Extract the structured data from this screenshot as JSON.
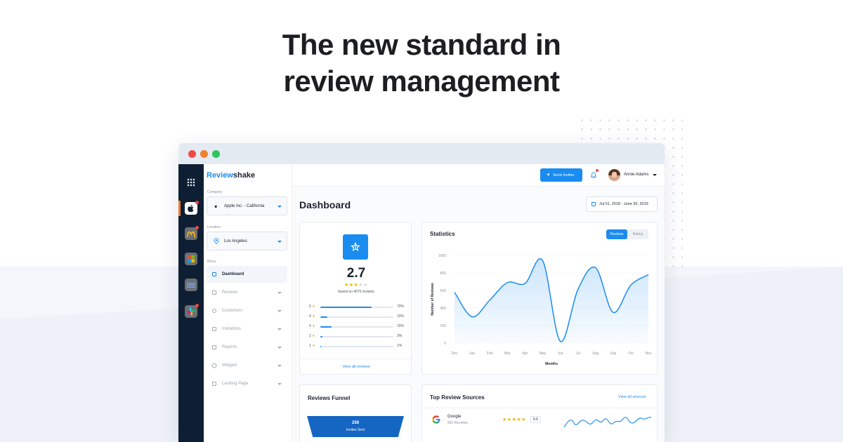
{
  "headline": {
    "line1": "The new standard in",
    "line2": "review management"
  },
  "brand": {
    "part1": "Review",
    "part2": "shake"
  },
  "sidebar": {
    "company_label": "Company",
    "company_value": "Apple Inc. - California",
    "location_label": "Location",
    "location_value": "Los Angeles",
    "menu_label": "Menu",
    "items": [
      {
        "label": "Dashboard"
      },
      {
        "label": "Reviews"
      },
      {
        "label": "Customers"
      },
      {
        "label": "Invitations"
      },
      {
        "label": "Reports"
      },
      {
        "label": "Widgets"
      },
      {
        "label": "Landing Page"
      }
    ]
  },
  "rail": {
    "items": [
      {
        "icon": "apple-icon",
        "color": "#ffffff"
      },
      {
        "icon": "mcdonalds-icon",
        "color": "#f0b323"
      },
      {
        "icon": "microsoft-icon",
        "color": "#f25022"
      },
      {
        "icon": "ibm-icon",
        "color": "#3b6fd8"
      },
      {
        "icon": "slack-icon",
        "color": "#e01e5a"
      }
    ]
  },
  "topbar": {
    "send_invites": "Send Invites",
    "user_name": "Annie Adams"
  },
  "dashboard": {
    "title": "Dashboard",
    "date_range": "Jul 01, 2018 - June 30, 2019"
  },
  "rating": {
    "value": "2.7",
    "stars_filled": 3,
    "stars_total": 5,
    "based_on": "based on 4070 reviews",
    "distribution": [
      {
        "stars": "5",
        "percent_label": "70%",
        "percent": 70
      },
      {
        "stars": "4",
        "percent_label": "10%",
        "percent": 10
      },
      {
        "stars": "3",
        "percent_label": "15%",
        "percent": 15
      },
      {
        "stars": "2",
        "percent_label": "3%",
        "percent": 3
      },
      {
        "stars": "1",
        "percent_label": "1%",
        "percent": 1
      }
    ],
    "view_all": "View all reviews"
  },
  "statistics": {
    "title": "Statistics",
    "toggle_on": "Reviews",
    "toggle_off": "Rating"
  },
  "chart_data": {
    "type": "area",
    "x": [
      "Dec",
      "Jan",
      "Feb",
      "Mar",
      "Apr",
      "May",
      "Jun",
      "Jul",
      "Aug",
      "Sep",
      "Oct",
      "Nov"
    ],
    "values": [
      580,
      300,
      490,
      690,
      680,
      940,
      20,
      610,
      860,
      350,
      660,
      780
    ],
    "ylim": [
      0,
      1000
    ],
    "yticks": [
      "0",
      "200",
      "400",
      "600",
      "800",
      "1000"
    ],
    "xlabel": "Months",
    "ylabel": "Number of Reviews",
    "grid": true,
    "line_color": "#1a8cf0"
  },
  "funnel": {
    "title": "Reviews Funnel",
    "value": "258",
    "label": "Invites Sent"
  },
  "sources": {
    "title": "Top Review Sources",
    "view_all": "View all sources",
    "items": [
      {
        "name": "Google",
        "count": "951 Reviews",
        "rating": "5.0",
        "stars": 5
      }
    ]
  },
  "colors": {
    "accent": "#1a8cf0",
    "rail": "#0f1f33",
    "star": "#f5b400"
  }
}
